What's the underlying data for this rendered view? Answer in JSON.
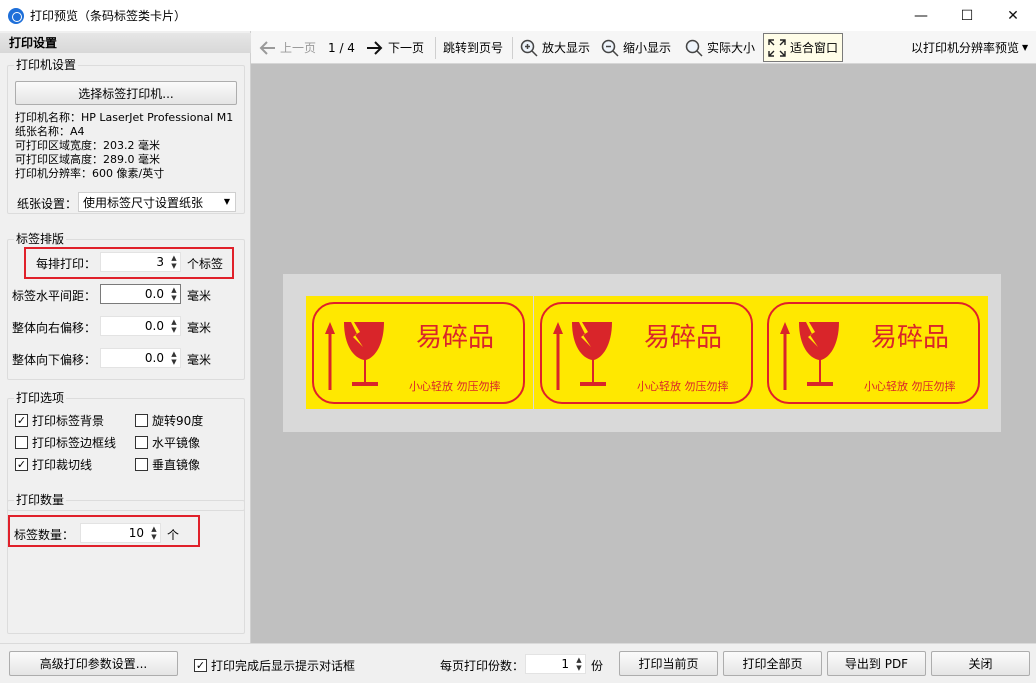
{
  "window": {
    "title": "打印预览（条码标签类卡片）",
    "minimize": "—",
    "maximize": "☐",
    "close": "✕"
  },
  "left_panel": {
    "header": "打印设置",
    "printer_group": {
      "title": "打印机设置",
      "select_button": "选择标签打印机...",
      "info": [
        "打印机名称：HP LaserJet Professional M1",
        "纸张名称：A4",
        "可打印区域宽度：203.2 毫米",
        "可打印区域高度：289.0 毫米",
        "打印机分辨率：600 像素/英寸"
      ],
      "paper_label": "纸张设置：",
      "paper_value": "使用标签尺寸设置纸张"
    },
    "layout_group": {
      "title": "标签排版",
      "per_row_label": "每排打印：",
      "per_row_value": "3",
      "per_row_unit": "个标签",
      "h_gap_label": "标签水平间距：",
      "h_gap_value": "0.0",
      "h_gap_unit": "毫米",
      "right_offset_label": "整体向右偏移：",
      "right_offset_value": "0.0",
      "right_offset_unit": "毫米",
      "down_offset_label": "整体向下偏移：",
      "down_offset_value": "0.0",
      "down_offset_unit": "毫米"
    },
    "options_group": {
      "title": "打印选项",
      "options": [
        {
          "label": "打印标签背景",
          "checked": true
        },
        {
          "label": "旋转90度",
          "checked": false
        },
        {
          "label": "打印标签边框线",
          "checked": false
        },
        {
          "label": "水平镜像",
          "checked": false
        },
        {
          "label": "打印裁切线",
          "checked": true
        },
        {
          "label": "垂直镜像",
          "checked": false
        }
      ]
    },
    "quantity_group": {
      "title": "打印数量",
      "count_label": "标签数量：",
      "count_value": "10",
      "count_unit": "个"
    }
  },
  "toolbar": {
    "prev_page": "上一页",
    "page_indicator": "1 / 4",
    "next_page": "下一页",
    "jump_page": "跳转到页号",
    "zoom_in": "放大显示",
    "zoom_out": "缩小显示",
    "actual_size": "实际大小",
    "fit_window": "适合窗口",
    "preview_mode": "以打印机分辨率预览"
  },
  "preview": {
    "labels": [
      {
        "title": "易碎品",
        "subtitle": "小心轻放  勿压勿摔"
      },
      {
        "title": "易碎品",
        "subtitle": "小心轻放  勿压勿摔"
      },
      {
        "title": "易碎品",
        "subtitle": "小心轻放  勿压勿摔"
      }
    ],
    "colors": {
      "label_bg": "#ffe800",
      "label_red": "#d9252a",
      "canvas": "#c0c0c0"
    }
  },
  "bottom": {
    "advanced_button": "高级打印参数设置...",
    "show_prompt_label": "打印完成后显示提示对话框",
    "show_prompt_checked": true,
    "copies_label": "每页打印份数：",
    "copies_value": "1",
    "copies_unit": "份",
    "print_current": "打印当前页",
    "print_all": "打印全部页",
    "export_pdf": "导出到 PDF",
    "close": "关闭"
  }
}
